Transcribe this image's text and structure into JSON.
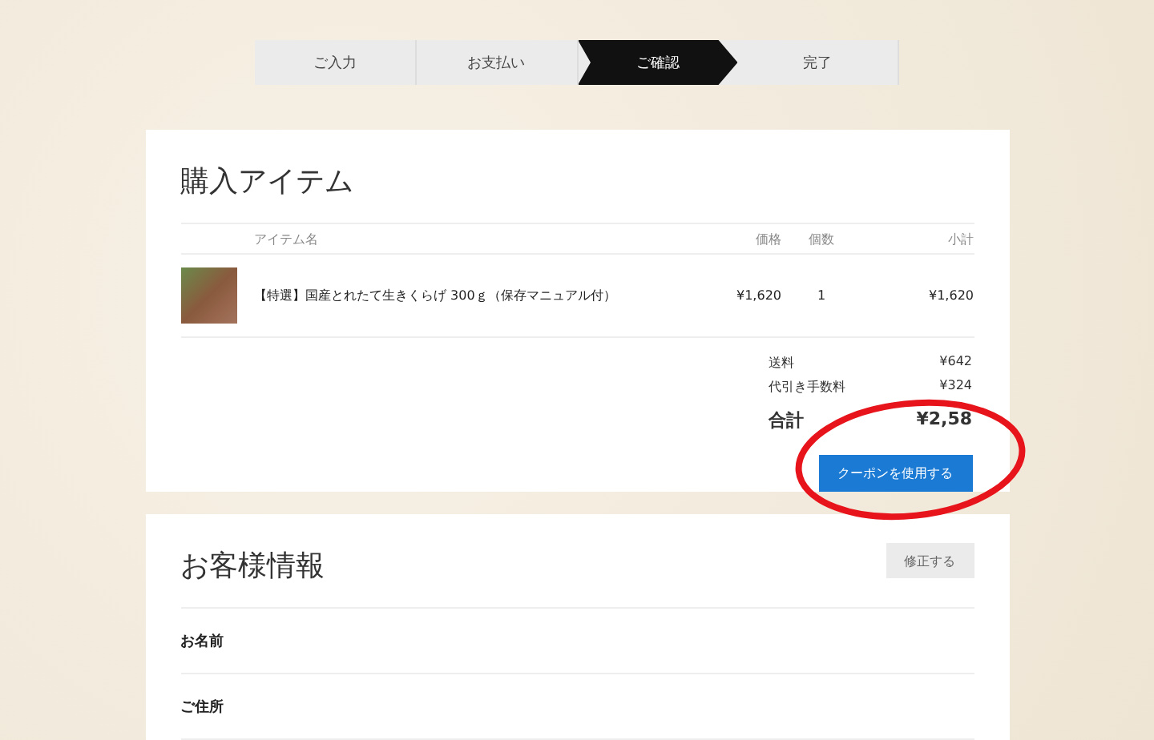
{
  "steps": [
    {
      "label": "ご入力",
      "selected": false
    },
    {
      "label": "お支払い",
      "selected": false
    },
    {
      "label": "ご確認",
      "selected": true
    },
    {
      "label": "完了",
      "selected": false
    }
  ],
  "items_section": {
    "title": "購入アイテム",
    "columns": [
      "アイテム名",
      "価格",
      "個数",
      "小計"
    ],
    "rows": [
      {
        "name": "【特選】国産とれたて生きくらげ 300ｇ（保存マニュアル付）",
        "price": "¥1,620",
        "qty": "1",
        "subtotal": "¥1,620"
      }
    ],
    "charges": [
      {
        "label": "送料",
        "value": "¥642"
      },
      {
        "label": "代引き手数料",
        "value": "¥324"
      }
    ],
    "total": {
      "label": "合計",
      "value": "¥2,58"
    },
    "coupon_button": "クーポンを使用する"
  },
  "customer_section": {
    "title": "お客様情報",
    "edit_button": "修正する",
    "fields": [
      "お名前",
      "ご住所"
    ]
  }
}
